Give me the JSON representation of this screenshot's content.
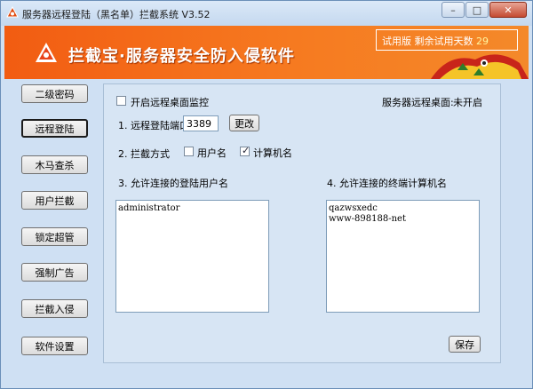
{
  "window": {
    "title": "服务器远程登陆（黑名单）拦截系统 V3.52",
    "minimize_glyph": "–",
    "maximize_glyph": "□",
    "close_glyph": "✕"
  },
  "banner": {
    "title": "拦截宝·服务器安全防入侵软件",
    "trial_label": "试用版  剩余试用天数",
    "trial_days": "29"
  },
  "nav": {
    "items": [
      {
        "label": "二级密码"
      },
      {
        "label": "远程登陆"
      },
      {
        "label": "木马查杀"
      },
      {
        "label": "用户拦截"
      },
      {
        "label": "锁定超管"
      },
      {
        "label": "强制广告"
      },
      {
        "label": "拦截入侵"
      },
      {
        "label": "软件设置"
      }
    ]
  },
  "main": {
    "monitor_label": "开启远程桌面监控",
    "status_label": "服务器远程桌面:",
    "status_value": "未开启",
    "port_label": "1. 远程登陆端口",
    "port_value": "3389",
    "change_button": "更改",
    "mode_label": "2. 拦截方式",
    "mode_username": "用户名",
    "mode_computer": "计算机名",
    "users_heading": "3. 允许连接的登陆用户名",
    "users": [
      "administrator"
    ],
    "hosts_heading": "4. 允许连接的终端计算机名",
    "hosts": [
      "qazwsxedc",
      "www-898188-net"
    ],
    "save_button": "保存"
  },
  "colors": {
    "banner": "#f25c12",
    "window_bg": "#cfe0f3",
    "panel_bg": "#d7e5f4"
  }
}
